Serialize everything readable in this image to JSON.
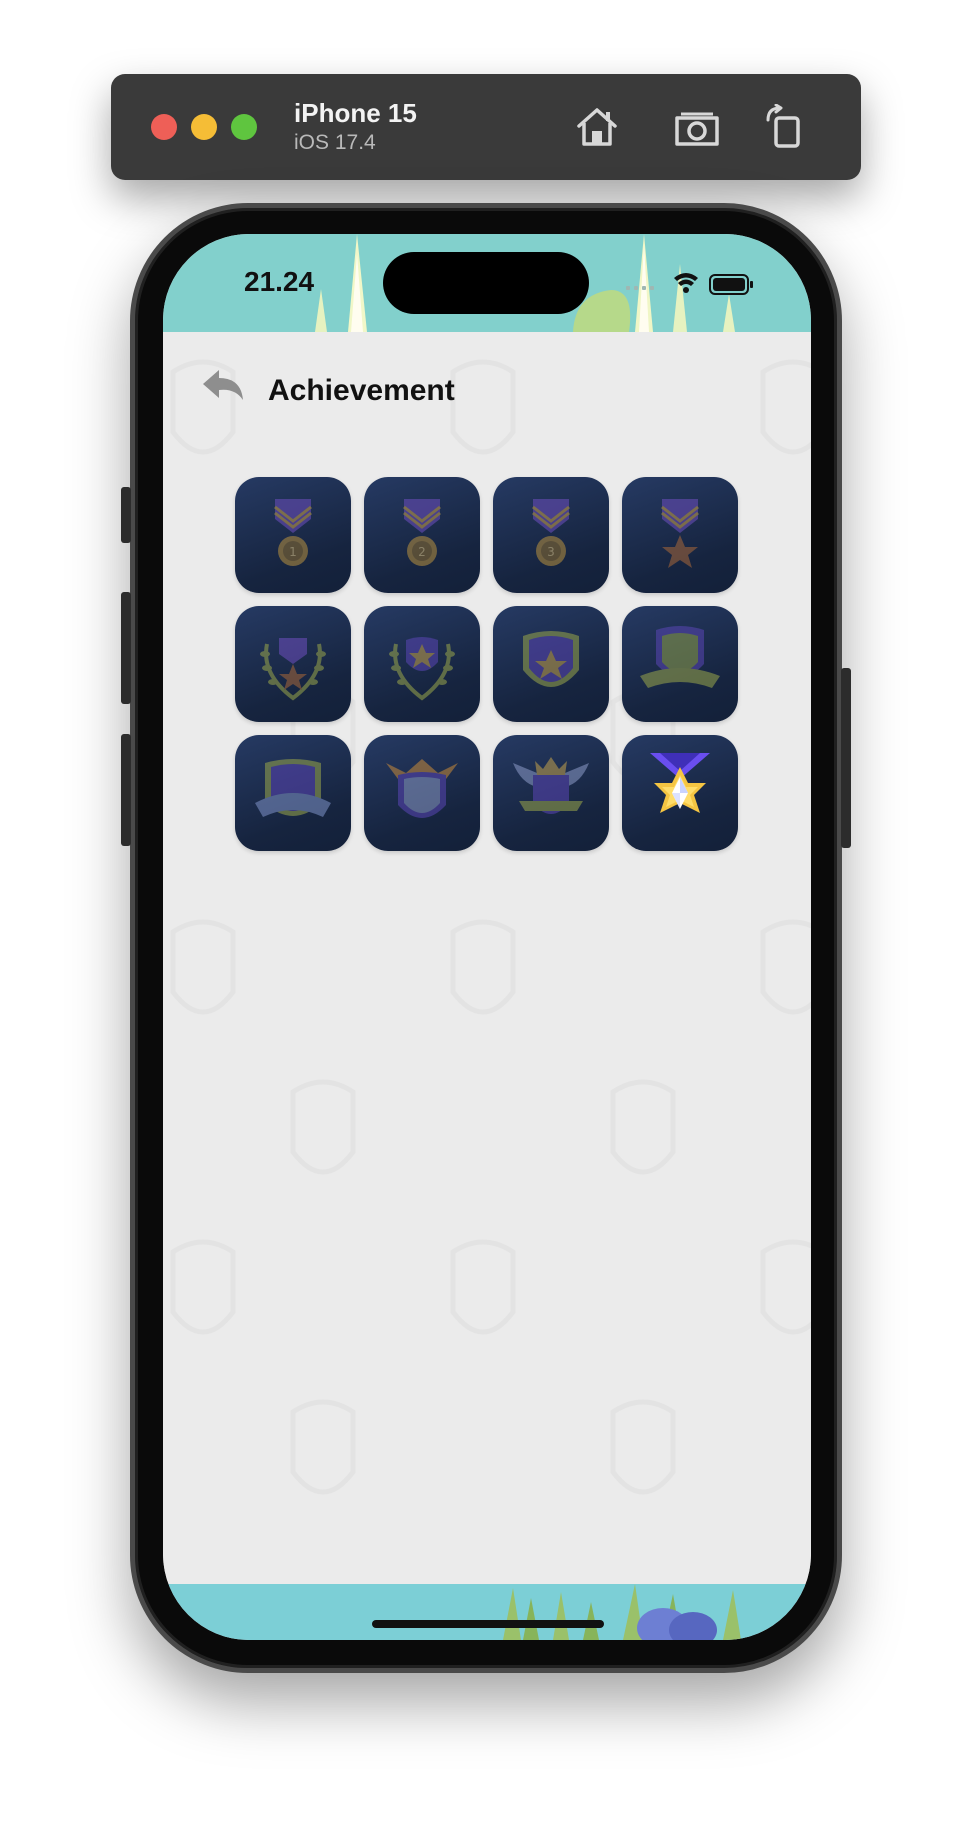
{
  "simulator": {
    "device_name": "iPhone 15",
    "os_version": "iOS 17.4",
    "buttons": [
      "home-icon",
      "screenshot-icon",
      "rotate-icon"
    ]
  },
  "status_bar": {
    "time": "21.24",
    "icons": [
      "cellular-icon",
      "wifi-icon",
      "battery-icon"
    ]
  },
  "header": {
    "back_icon": "back-arrow-icon",
    "title": "Achievement"
  },
  "achievements": [
    {
      "icon": "medal-1-icon",
      "unlocked": false
    },
    {
      "icon": "medal-2-icon",
      "unlocked": false
    },
    {
      "icon": "medal-3-icon",
      "unlocked": false
    },
    {
      "icon": "medal-star-icon",
      "unlocked": false
    },
    {
      "icon": "laurel-medal-icon",
      "unlocked": false
    },
    {
      "icon": "laurel-shield-icon",
      "unlocked": false
    },
    {
      "icon": "star-shield-icon",
      "unlocked": false
    },
    {
      "icon": "banner-shield-icon",
      "unlocked": false
    },
    {
      "icon": "ribbon-shield-icon",
      "unlocked": false
    },
    {
      "icon": "crown-shield-icon",
      "unlocked": false
    },
    {
      "icon": "winged-crown-shield-icon",
      "unlocked": false
    },
    {
      "icon": "diamond-star-medal-icon",
      "unlocked": true
    }
  ],
  "colors": {
    "badge_tile": "#1b2a4a",
    "page_background": "#ebebeb",
    "scene_top": "#82d0cc",
    "scene_bottom": "#7ccfd6",
    "unlocked_gold": "#f5c542",
    "unlocked_purple": "#6a4ef0"
  }
}
